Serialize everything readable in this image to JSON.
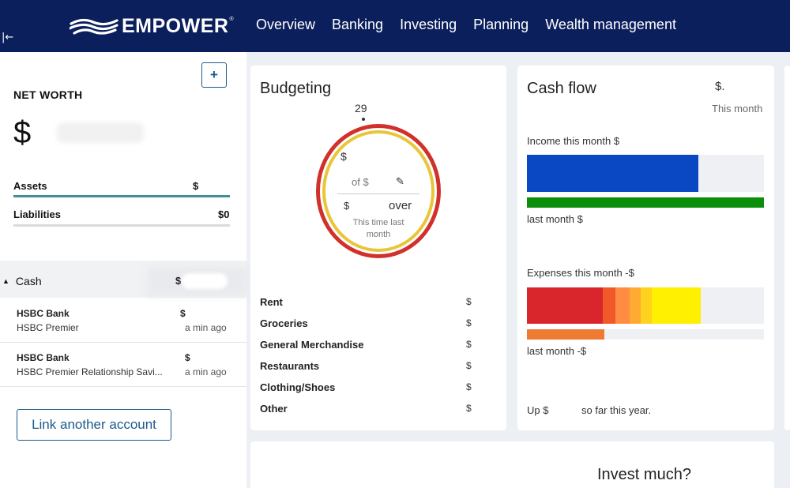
{
  "nav": {
    "brand": "EMPOWER",
    "collapse_glyph": "|←",
    "items": [
      "Overview",
      "Banking",
      "Investing",
      "Planning",
      "Wealth management"
    ]
  },
  "sidebar": {
    "add_glyph": "+",
    "net_worth_label": "NET WORTH",
    "net_worth_symbol": "$",
    "assets_label": "Assets",
    "assets_value": "$",
    "liabilities_label": "Liabilities",
    "liabilities_value": "$0",
    "cash": {
      "label": "Cash",
      "value": "$"
    },
    "accounts": [
      {
        "name": "HSBC Bank",
        "sub": "HSBC Premier",
        "value": "$",
        "updated": "a min ago"
      },
      {
        "name": "HSBC Bank",
        "sub": "HSBC Premier Relationship Savi...",
        "value": "$",
        "updated": "a min ago"
      }
    ],
    "link_button": "Link another account"
  },
  "budgeting": {
    "title": "Budgeting",
    "day": "29",
    "spent_symbol": "$",
    "of_label": "of $",
    "delta_symbol": "$",
    "over_label": "over",
    "last_month_label": "This time last month",
    "categories": [
      {
        "name": "Rent",
        "value": "$"
      },
      {
        "name": "Groceries",
        "value": "$"
      },
      {
        "name": "General Merchandise",
        "value": "$"
      },
      {
        "name": "Restaurants",
        "value": "$"
      },
      {
        "name": "Clothing/Shoes",
        "value": "$"
      },
      {
        "name": "Other",
        "value": "$"
      }
    ]
  },
  "cashflow": {
    "title": "Cash flow",
    "total_symbol": "$.",
    "period": "This month",
    "income_label": "Income this month $",
    "income_last_label": "last month $",
    "expenses_label": "Expenses this month -$",
    "expenses_last_label": "last month -$",
    "ytd_prefix": "Up $",
    "ytd_suffix": "so far this year.",
    "colors": {
      "income": "#0a47c2",
      "income_last": "#0a8f0a",
      "expense_1": "#d9262c",
      "expense_2": "#f05a28",
      "expense_3": "#ff8c42",
      "expense_4": "#ffaa33",
      "expense_5": "#ffd21f",
      "expense_6": "#ffef00",
      "expense_last": "#ef7b32"
    }
  },
  "invest": {
    "title": "Invest much?"
  }
}
